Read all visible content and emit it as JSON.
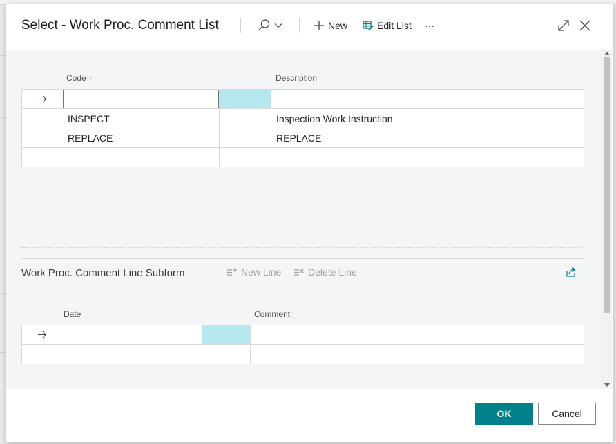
{
  "dialog": {
    "title": "Select - Work Proc. Comment List",
    "toolbar": {
      "new_label": "New",
      "edit_list_label": "Edit List",
      "more_label": "···"
    }
  },
  "list": {
    "columns": {
      "code": "Code",
      "code_sort_indicator": "↑",
      "description": "Description"
    },
    "rows": [
      {
        "code": "INSPECT",
        "description": "Inspection Work Instruction"
      },
      {
        "code": "REPLACE",
        "description": "REPLACE"
      }
    ]
  },
  "subform": {
    "title": "Work Proc. Comment Line Subform",
    "new_line_label": "New Line",
    "delete_line_label": "Delete Line",
    "columns": {
      "date": "Date",
      "comment": "Comment"
    }
  },
  "footer": {
    "ok_label": "OK",
    "cancel_label": "Cancel"
  },
  "colors": {
    "accent": "#00808a",
    "selection": "#b5e8ee"
  }
}
